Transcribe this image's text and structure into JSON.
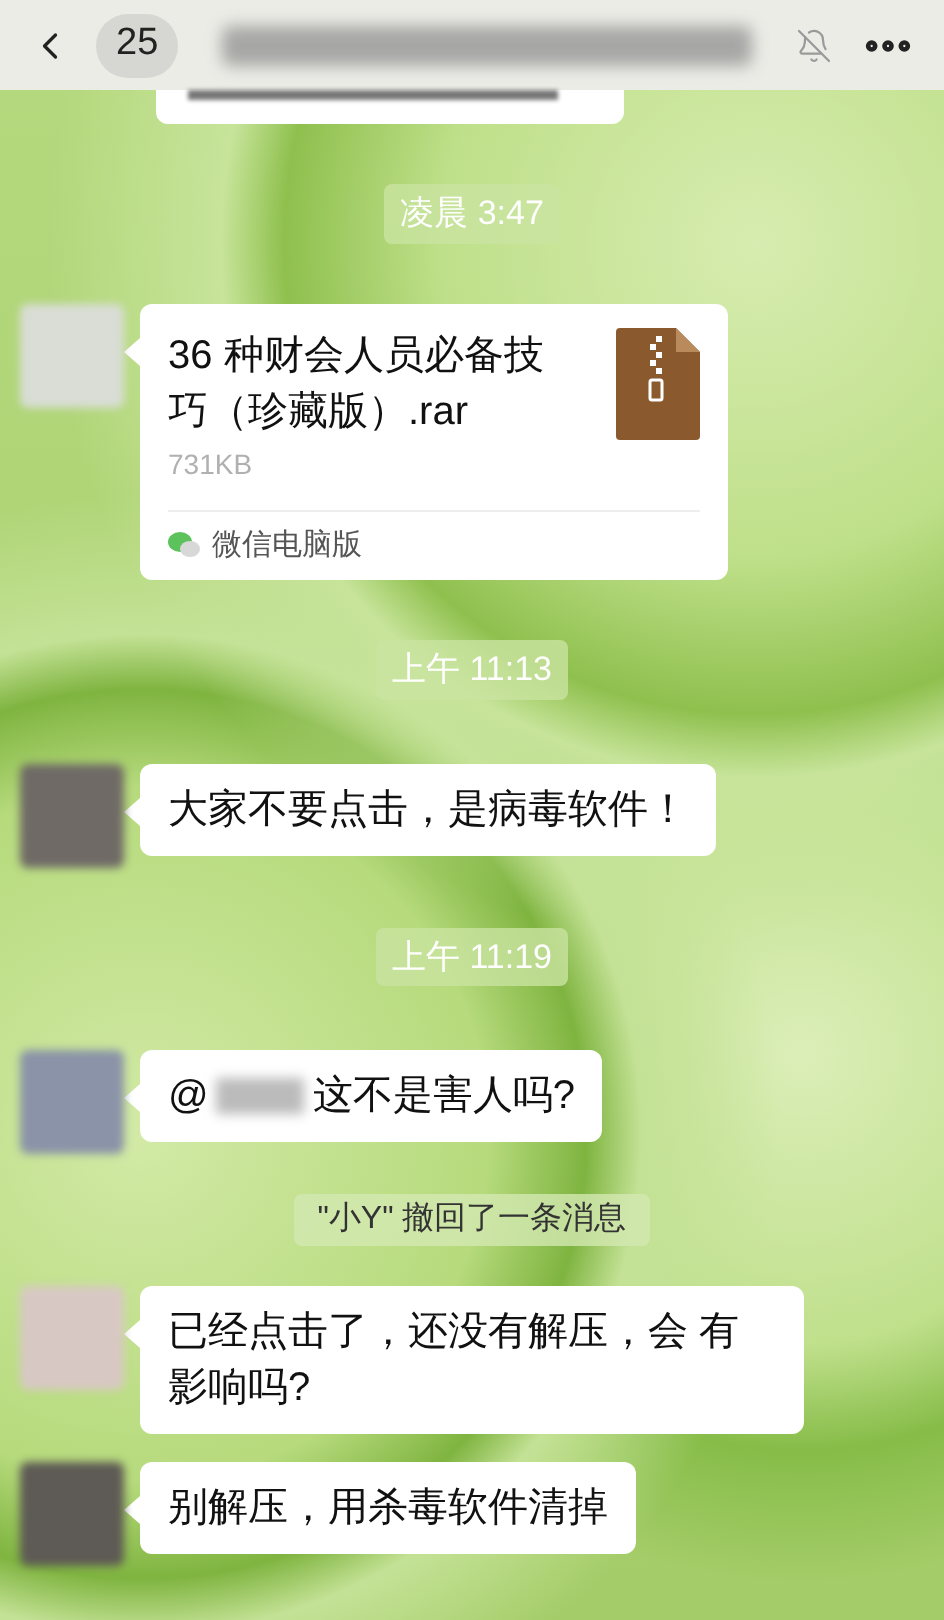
{
  "header": {
    "back_count": "25"
  },
  "messages": [
    {
      "kind": "time",
      "text": "凌晨 3:47"
    },
    {
      "kind": "file",
      "name": "36 种财会人员必备技巧（珍藏版）.rar",
      "size": "731KB",
      "source": "微信电脑版"
    },
    {
      "kind": "time",
      "text": "上午 11:13"
    },
    {
      "kind": "text",
      "text": "大家不要点击，是病毒软件！"
    },
    {
      "kind": "time",
      "text": "上午 11:19"
    },
    {
      "kind": "mention",
      "prefix": "@",
      "text": "这不是害人吗?"
    },
    {
      "kind": "recall",
      "text": "\"小Y\" 撤回了一条消息"
    },
    {
      "kind": "text",
      "text": "已经点击了，还没有解压，会 有影响吗?"
    },
    {
      "kind": "text",
      "text": "别解压，用杀毒软件清掉"
    }
  ]
}
